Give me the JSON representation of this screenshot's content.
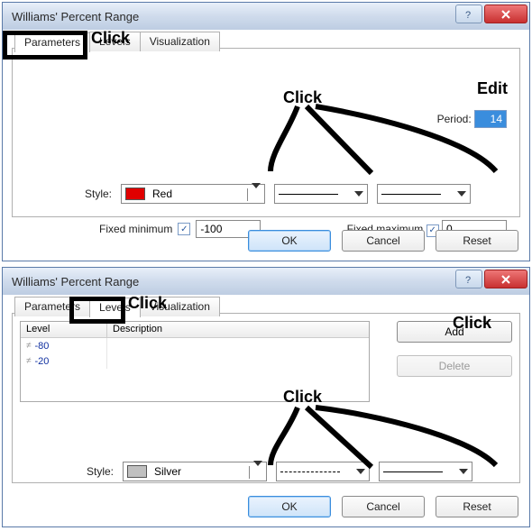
{
  "annotation": {
    "click": "Click",
    "edit": "Edit"
  },
  "dialog1": {
    "title": "Williams' Percent Range",
    "tabs": [
      "Parameters",
      "Levels",
      "Visualization"
    ],
    "active_tab": 0,
    "period_label": "Period:",
    "period_value": "14",
    "style_label": "Style:",
    "color_name": "Red",
    "fixed_min_label": "Fixed minimum",
    "fixed_min_checked": true,
    "fixed_min_value": "-100",
    "fixed_max_label": "Fixed maximum",
    "fixed_max_checked": true,
    "fixed_max_value": "0",
    "buttons": {
      "ok": "OK",
      "cancel": "Cancel",
      "reset": "Reset"
    }
  },
  "dialog2": {
    "title": "Williams' Percent Range",
    "tabs": [
      "Parameters",
      "Levels",
      "Visualization"
    ],
    "active_tab": 1,
    "levels_headers": {
      "level": "Level",
      "description": "Description"
    },
    "levels": [
      {
        "value": "-80",
        "description": ""
      },
      {
        "value": "-20",
        "description": ""
      }
    ],
    "add_label": "Add",
    "delete_label": "Delete",
    "style_label": "Style:",
    "color_name": "Silver",
    "buttons": {
      "ok": "OK",
      "cancel": "Cancel",
      "reset": "Reset"
    }
  }
}
